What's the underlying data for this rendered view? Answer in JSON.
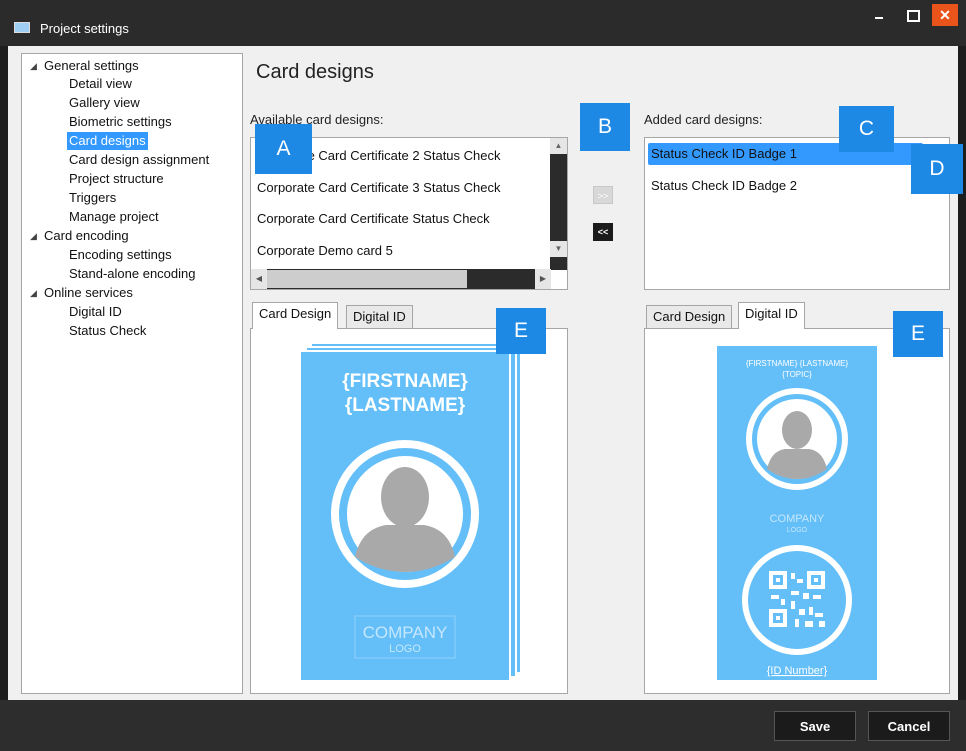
{
  "window": {
    "title": "Project settings"
  },
  "controls": {
    "close_glyph": "✕"
  },
  "tree": [
    {
      "label": "General settings",
      "expanded": true
    },
    {
      "label": "Detail view"
    },
    {
      "label": "Gallery view"
    },
    {
      "label": "Biometric settings"
    },
    {
      "label": "Card designs",
      "selected": true
    },
    {
      "label": "Card design assignment"
    },
    {
      "label": "Project structure"
    },
    {
      "label": "Triggers"
    },
    {
      "label": "Manage project"
    },
    {
      "label": "Card encoding",
      "expanded": true
    },
    {
      "label": "Encoding settings"
    },
    {
      "label": "Stand-alone encoding"
    },
    {
      "label": "Online services",
      "expanded": true
    },
    {
      "label": "Digital ID"
    },
    {
      "label": "Status Check"
    }
  ],
  "page": {
    "title": "Card designs"
  },
  "available": {
    "label": "Available card designs:",
    "items": [
      "Corporate Card Certificate 2 Status Check",
      "Corporate Card Certificate 3 Status Check",
      "Corporate Card Certificate Status Check",
      "Corporate Demo card 5"
    ]
  },
  "added": {
    "label": "Added card designs:",
    "items": [
      "Status Check ID Badge 1",
      "Status Check ID Badge 2"
    ]
  },
  "transfer": {
    "add_label": ">>",
    "remove_label": "<<"
  },
  "tabs": {
    "card_design": "Card Design",
    "digital_id": "Digital ID"
  },
  "left_preview": {
    "active_tab": "Card Design",
    "firstname": "{FIRSTNAME}",
    "lastname": "{LASTNAME}",
    "company": "COMPANY",
    "logo": "LOGO",
    "card_color": "#64bff8"
  },
  "right_preview": {
    "active_tab": "Digital ID",
    "names": "{FIRSTNAME} {LASTNAME}",
    "topic": "{TOPIC}",
    "company": "COMPANY",
    "logo": "LOGO",
    "id_number": "{ID Number}",
    "card_color": "#64bff8"
  },
  "callouts": [
    "A",
    "B",
    "C",
    "D",
    "E",
    "E"
  ],
  "footer": {
    "save_label": "Save",
    "cancel_label": "Cancel"
  },
  "colors": {
    "accent": "#3399ff",
    "callout": "#1e88e5",
    "close": "#e8541a"
  }
}
